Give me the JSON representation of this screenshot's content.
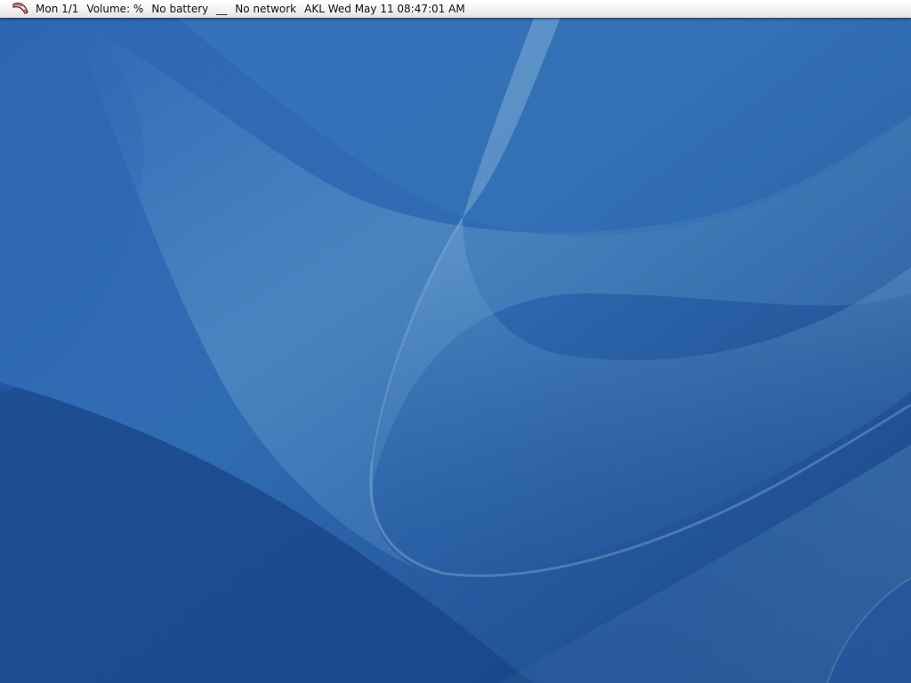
{
  "statusbar": {
    "logo_icon": "scarf-logo-icon",
    "workspace": "Mon 1/1",
    "volume": "Volume: %",
    "battery": "No battery",
    "separator": "__",
    "network": "No network",
    "clock": "AKL Wed May 11 08:47:01 AM"
  },
  "desktop": {
    "wallpaper_colors": {
      "deep": "#1e4d93",
      "mid": "#2e6bb8",
      "light": "#5a9ad0",
      "highlight": "#8bbde0"
    }
  }
}
